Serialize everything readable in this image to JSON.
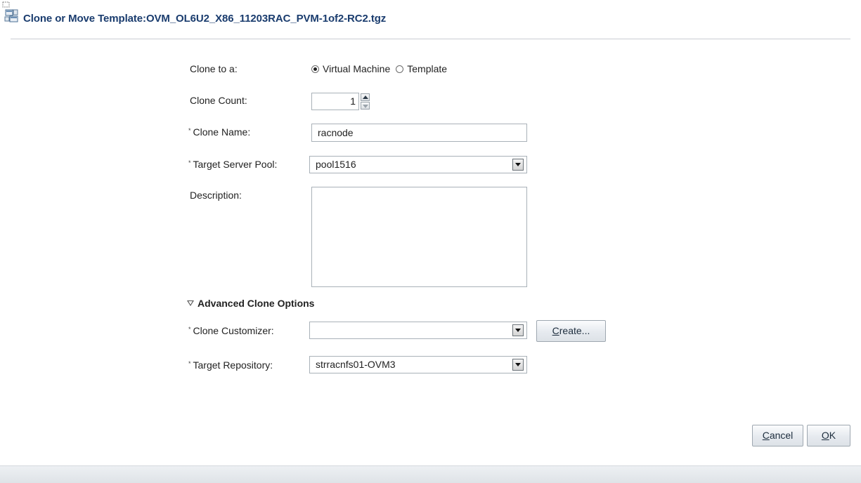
{
  "dialog": {
    "title": "Clone or Move Template:OVM_OL6U2_X86_11203RAC_PVM-1of2-RC2.tgz",
    "title_icon": "template-icon"
  },
  "form": {
    "clone_to": {
      "label": "Clone to a:",
      "options": [
        "Virtual Machine",
        "Template"
      ],
      "selected": "Virtual Machine"
    },
    "clone_count": {
      "label": "Clone Count:",
      "value": "1"
    },
    "clone_name": {
      "required_mark": "*",
      "label": "Clone Name:",
      "value": "racnode"
    },
    "target_server_pool": {
      "required_mark": "*",
      "label": "Target Server Pool:",
      "value": "pool1516"
    },
    "description": {
      "label": "Description:",
      "value": ""
    }
  },
  "advanced": {
    "header": "Advanced Clone Options",
    "expanded": true,
    "clone_customizer": {
      "required_mark": "*",
      "label": "Clone Customizer:",
      "value": "",
      "create_button": {
        "mnemonic": "C",
        "rest": "reate..."
      }
    },
    "target_repository": {
      "required_mark": "*",
      "label": "Target Repository:",
      "value": "strracnfs01-OVM3"
    }
  },
  "footer": {
    "cancel_button": {
      "mnemonic": "C",
      "rest": "ancel"
    },
    "ok_button": {
      "mnemonic": "O",
      "rest": "K"
    }
  },
  "colors": {
    "title_text": "#1a3c6e",
    "border": "#a9b1b8",
    "button_text": "#1d2d3d"
  }
}
